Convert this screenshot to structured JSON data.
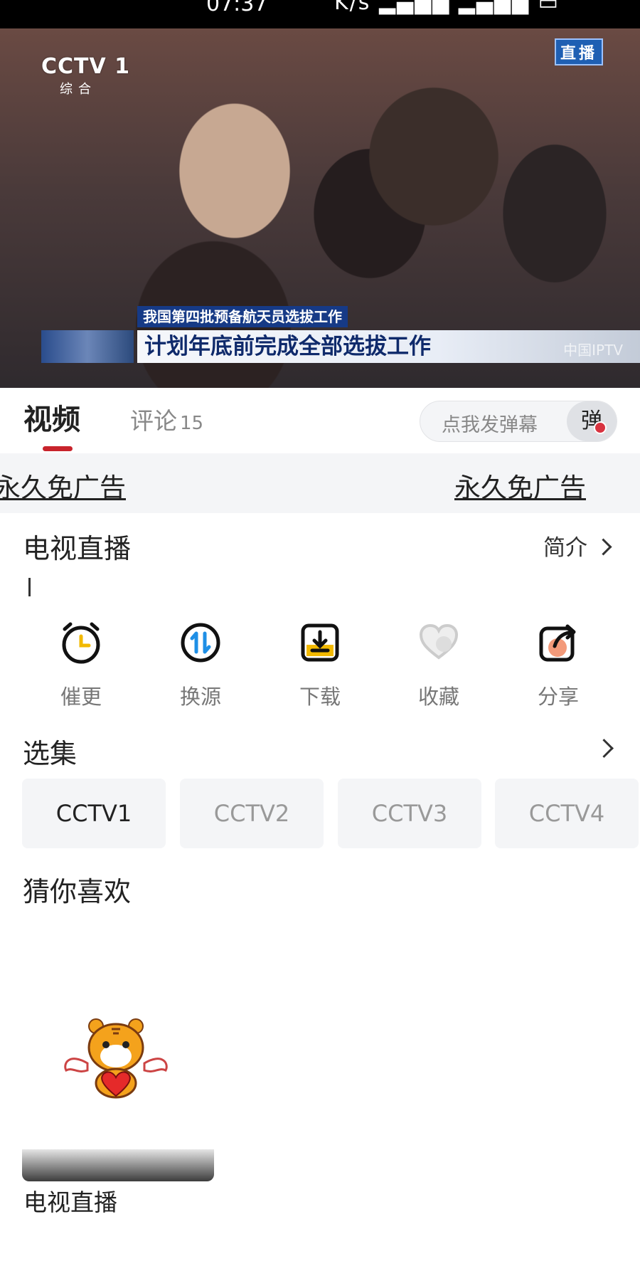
{
  "status_bar": {
    "time": "07:37",
    "indicators": "K/s"
  },
  "player": {
    "channel_logo": "CCTV 1",
    "channel_sub": "综合",
    "live_badge": "直播",
    "headline_sub": "我国第四批预备航天员选拔工作",
    "headline_main": "计划年底前完成全部选拔工作",
    "watermark": "中国IPTV"
  },
  "tabs": {
    "video": "视频",
    "comments": "评论",
    "comments_count": "15"
  },
  "danmu": {
    "placeholder": "点我发弹幕",
    "button": "弹"
  },
  "ad_strip": {
    "left": "永久免广告",
    "right": "永久免广告"
  },
  "show": {
    "title": "电视直播",
    "intro": "简介"
  },
  "actions": [
    {
      "label": "催更",
      "icon": "alarm-clock-icon"
    },
    {
      "label": "换源",
      "icon": "switch-source-icon"
    },
    {
      "label": "下载",
      "icon": "download-icon"
    },
    {
      "label": "收藏",
      "icon": "heart-icon"
    },
    {
      "label": "分享",
      "icon": "share-icon"
    }
  ],
  "episodes": {
    "title": "选集",
    "items": [
      "CCTV1",
      "CCTV2",
      "CCTV3",
      "CCTV4"
    ]
  },
  "recommend": {
    "title": "猜你喜欢",
    "card_title": "电视直播"
  },
  "colors": {
    "accent": "#c8232c",
    "live_badge": "#1e5fb3"
  }
}
